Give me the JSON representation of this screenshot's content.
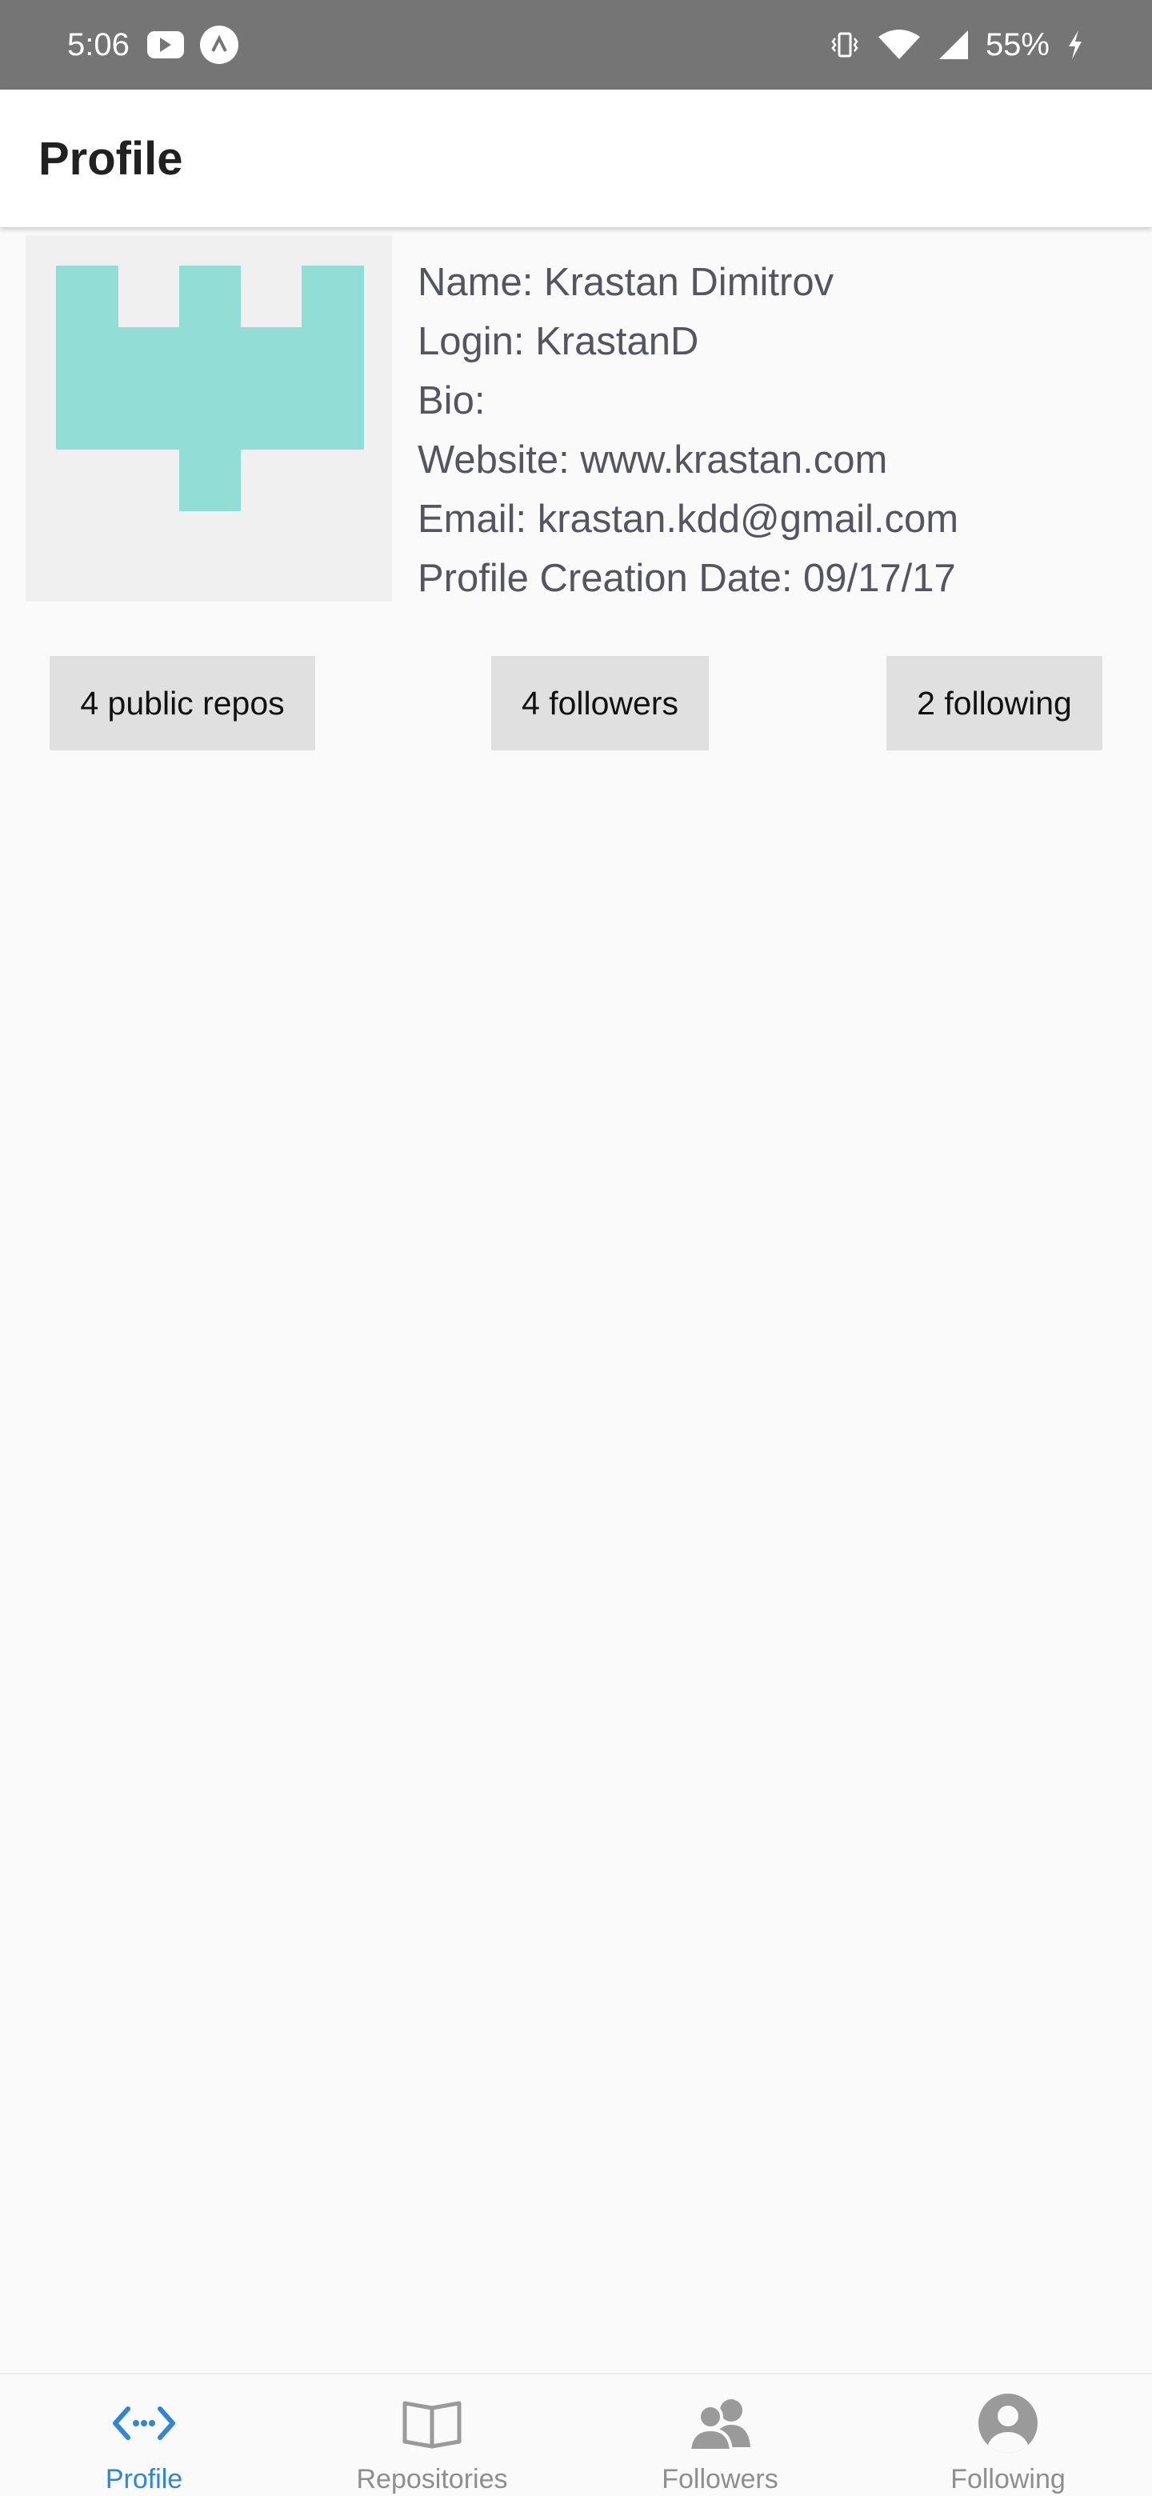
{
  "status_bar": {
    "time": "5:06",
    "battery": "55%",
    "icons": [
      "youtube-icon",
      "app-icon",
      "vibrate-icon",
      "wifi-icon",
      "signal-icon",
      "charging-icon"
    ]
  },
  "app_bar": {
    "title": "Profile"
  },
  "profile": {
    "name": "Name: Krastan Dimitrov",
    "login": "Login: KrastanD",
    "bio": "Bio:",
    "website": "Website: www.krastan.com",
    "email": "Email: krastan.kdd@gmail.com",
    "created": "Profile Creation Date: 09/17/17",
    "avatar_color": "#92ddd6"
  },
  "stats": {
    "repos": "4 public repos",
    "followers": "4 followers",
    "following": "2 following"
  },
  "bottom_nav": {
    "active_color": "#2f86d6",
    "items": [
      {
        "label": "Profile",
        "icon": "code-icon"
      },
      {
        "label": "Repositories",
        "icon": "book-icon"
      },
      {
        "label": "Followers",
        "icon": "people-icon"
      },
      {
        "label": "Following",
        "icon": "person-icon"
      }
    ]
  }
}
